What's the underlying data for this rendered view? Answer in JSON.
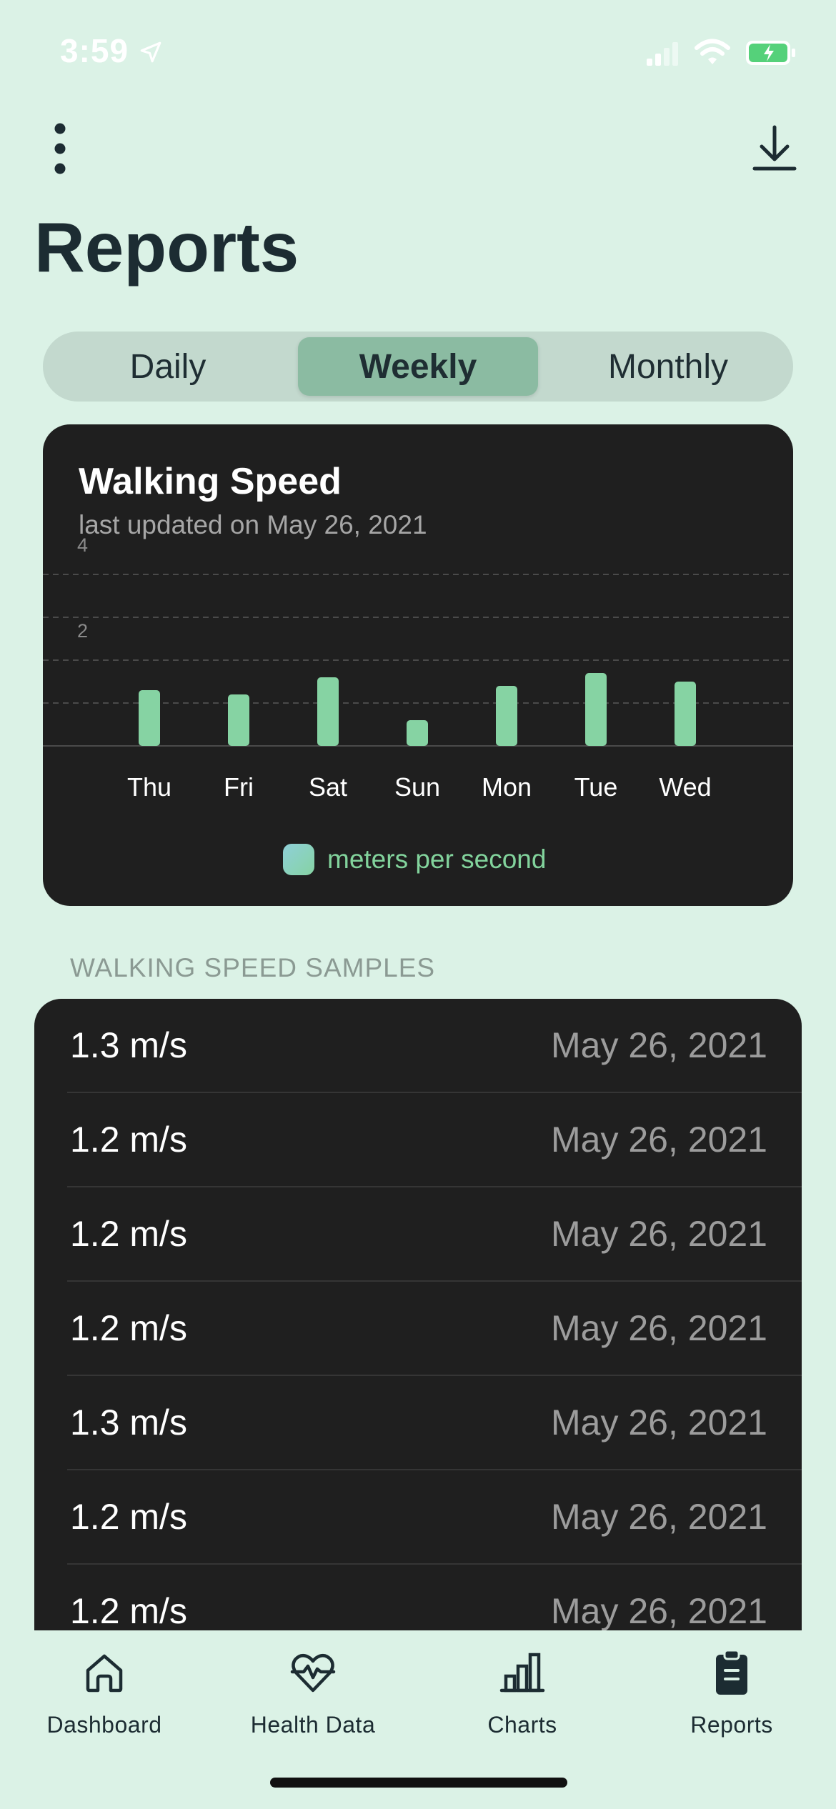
{
  "status_bar": {
    "time": "3:59",
    "icons": [
      "location-arrow-icon",
      "signal-icon",
      "wifi-icon",
      "battery-charging-icon"
    ]
  },
  "toolbar": {
    "more_icon": "more-vertical-icon",
    "download_icon": "download-icon"
  },
  "page": {
    "title": "Reports"
  },
  "segments": {
    "items": [
      "Daily",
      "Weekly",
      "Monthly"
    ],
    "selected": "Weekly"
  },
  "chart_card": {
    "title": "Walking Speed",
    "subtitle": "last updated on May 26, 2021"
  },
  "chart_data": {
    "type": "bar",
    "title": "Walking Speed",
    "subtitle": "last updated on May 26, 2021",
    "categories": [
      "Thu",
      "Fri",
      "Sat",
      "Sun",
      "Mon",
      "Tue",
      "Wed"
    ],
    "series": [
      {
        "name": "meters per second",
        "values": [
          1.3,
          1.2,
          1.6,
          0.6,
          1.4,
          1.7,
          1.5
        ]
      }
    ],
    "ylim": [
      0,
      4
    ],
    "y_ticks": [
      2,
      4
    ],
    "grid": true,
    "legend": "bottom",
    "colors": {
      "bar": "#86d3a3",
      "legend_text": "#82d39c"
    }
  },
  "samples": {
    "header": "WALKING SPEED SAMPLES",
    "rows": [
      {
        "value": "1.3 m/s",
        "date": "May 26, 2021"
      },
      {
        "value": "1.2 m/s",
        "date": "May 26, 2021"
      },
      {
        "value": "1.2 m/s",
        "date": "May 26, 2021"
      },
      {
        "value": "1.2 m/s",
        "date": "May 26, 2021"
      },
      {
        "value": "1.3 m/s",
        "date": "May 26, 2021"
      },
      {
        "value": "1.2 m/s",
        "date": "May 26, 2021"
      },
      {
        "value": "1.2 m/s",
        "date": "May 26, 2021"
      }
    ]
  },
  "tabbar": {
    "items": [
      {
        "label": "Dashboard",
        "icon": "home-icon"
      },
      {
        "label": "Health Data",
        "icon": "heart-pulse-icon"
      },
      {
        "label": "Charts",
        "icon": "bar-chart-icon"
      },
      {
        "label": "Reports",
        "icon": "clipboard-icon"
      }
    ],
    "active": "Reports"
  },
  "colors": {
    "background": "#dbf2e6",
    "card": "#1f1f1f",
    "accent": "#86d3a3",
    "segment_selected": "#8bbba2"
  }
}
